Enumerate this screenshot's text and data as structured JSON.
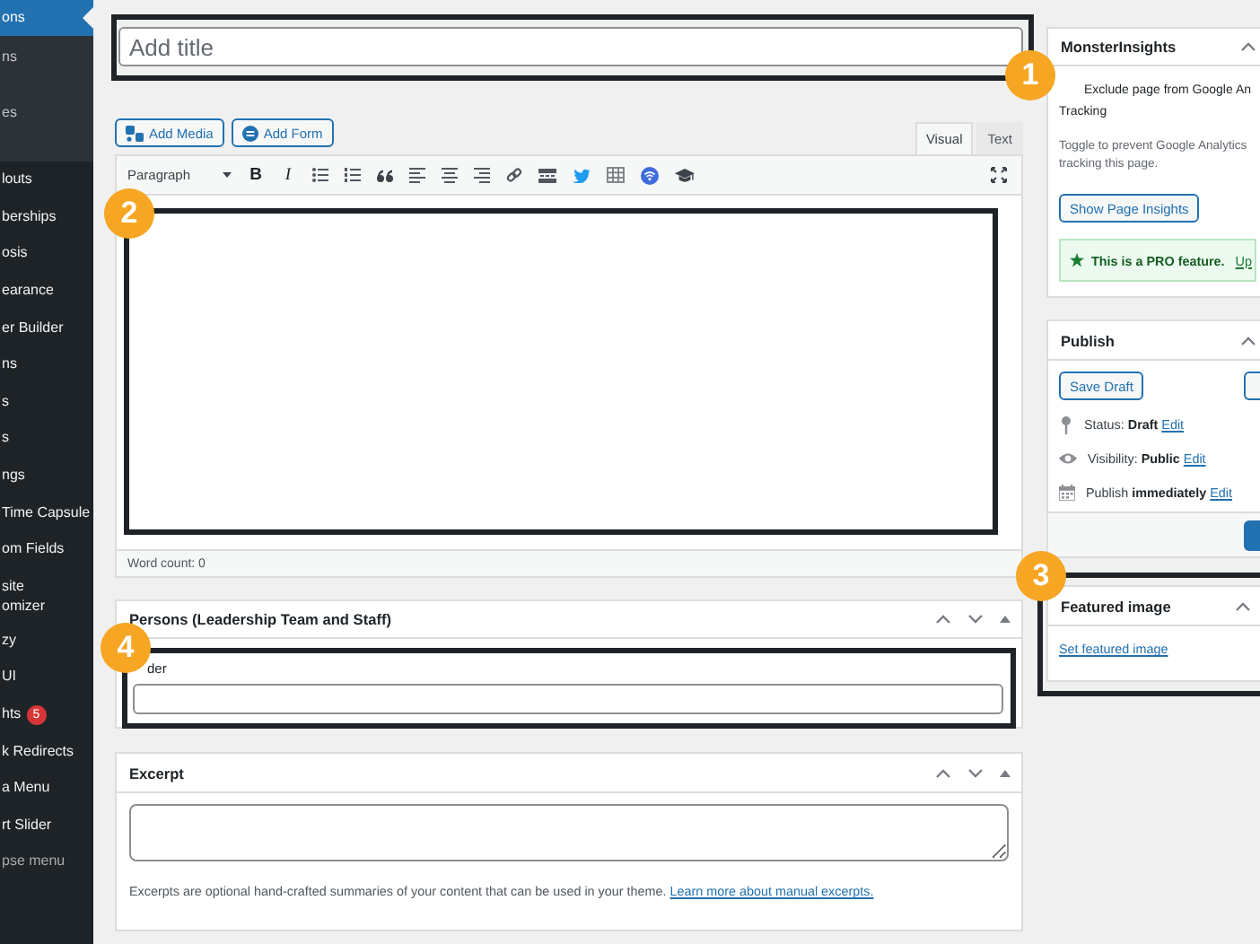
{
  "sidebar": {
    "items": [
      {
        "label": "ons",
        "kind": "top",
        "selected": true
      },
      {
        "label": "ns",
        "kind": "sub",
        "selected": false
      },
      {
        "label": "es",
        "kind": "sub",
        "selected": false
      },
      {
        "label": "louts",
        "kind": "top",
        "selected": false
      },
      {
        "label": "berships",
        "kind": "top",
        "selected": false
      },
      {
        "label": "osis",
        "kind": "top",
        "selected": false
      },
      {
        "label": "earance",
        "kind": "top",
        "selected": false
      },
      {
        "label": "er Builder",
        "kind": "top",
        "selected": false
      },
      {
        "label": "ns",
        "kind": "top",
        "selected": false
      },
      {
        "label": "s",
        "kind": "top",
        "selected": false
      },
      {
        "label": "s",
        "kind": "top",
        "selected": false
      },
      {
        "label": "ngs",
        "kind": "top",
        "selected": false
      },
      {
        "label": "Time Capsule",
        "kind": "top",
        "selected": false
      },
      {
        "label": "om Fields",
        "kind": "top",
        "selected": false
      },
      {
        "label": "site\nomizer",
        "kind": "top",
        "selected": false
      },
      {
        "label": "zy",
        "kind": "top",
        "selected": false
      },
      {
        "label": "UI",
        "kind": "top",
        "selected": false
      },
      {
        "label": "hts",
        "kind": "top",
        "selected": false,
        "badge": "5"
      },
      {
        "label": "k Redirects",
        "kind": "top",
        "selected": false
      },
      {
        "label": "a Menu",
        "kind": "top",
        "selected": false
      },
      {
        "label": "rt Slider",
        "kind": "top",
        "selected": false
      },
      {
        "label": "pse menu",
        "kind": "collapse",
        "selected": false
      }
    ]
  },
  "title_field": {
    "placeholder": "Add title",
    "marker": "1"
  },
  "editor": {
    "buttons": [
      {
        "label": "Add Media",
        "kind": "media"
      },
      {
        "label": "Add Form",
        "kind": "form"
      }
    ],
    "tabs": [
      {
        "label": "Visual",
        "selected": true
      },
      {
        "label": "Text",
        "selected": false
      }
    ],
    "format": "Paragraph",
    "toolbar": {
      "bold": "B",
      "italic": "I"
    },
    "marker": "2",
    "word_count": "Word count: 0"
  },
  "persons": {
    "title": "Persons (Leadership Team and Staff)",
    "field_label": "der",
    "marker": "4"
  },
  "excerpt": {
    "title": "Excerpt",
    "help": "Excerpts are optional hand-crafted summaries of your content that can be used in your theme.",
    "link": "Learn more about manual excerpts."
  },
  "monsterinsights": {
    "title": "MonsterInsights",
    "option_lines": [
      "Exclude page from Google An",
      "Tracking"
    ],
    "description": "Toggle to prevent Google Analytics tracking this page.",
    "button": "Show Page Insights",
    "pro_notice": "This is a PRO feature.",
    "pro_link": "Up"
  },
  "publish": {
    "title": "Publish",
    "button": "Save Draft",
    "rows": [
      {
        "kind": "status",
        "label": "Status:",
        "value": "Draft",
        "link": "Edit"
      },
      {
        "kind": "visibility",
        "label": "Visibility:",
        "value": "Public",
        "link": "Edit"
      },
      {
        "kind": "schedule",
        "label": "Publish",
        "value": "immediately",
        "link": "Edit"
      }
    ]
  },
  "featured_image": {
    "title": "Featured image",
    "link": "Set featured image",
    "marker": "3"
  }
}
